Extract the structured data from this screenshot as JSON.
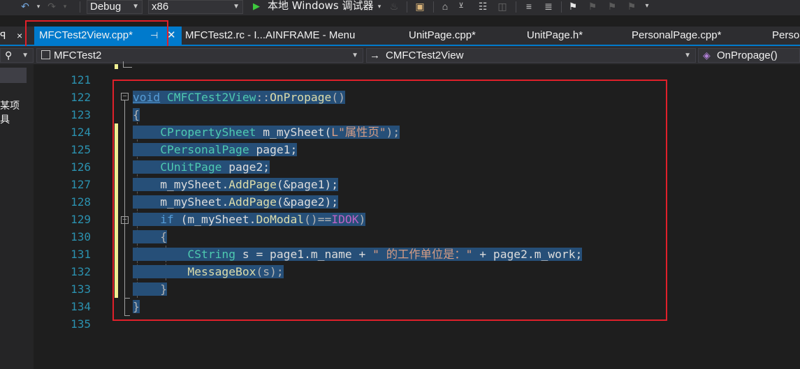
{
  "toolbar": {
    "configuration": "Debug",
    "platform": "x86",
    "run_label": "本地 Windows 调试器"
  },
  "tabs": [
    {
      "label": "MFCTest2View.cpp*",
      "active": true
    },
    {
      "label": "MFCTest2.rc - I...AINFRAME - Menu"
    },
    {
      "label": "UnitPage.cpp*"
    },
    {
      "label": "UnitPage.h*"
    },
    {
      "label": "PersonalPage.cpp*"
    },
    {
      "label": "Perso"
    }
  ],
  "navbar": {
    "project": "MFCTest2",
    "class": "CMFCTest2View",
    "member": "OnPropage()"
  },
  "side_panel": {
    "items": [
      "某项",
      "具"
    ]
  },
  "editor": {
    "lines": [
      {
        "num": "121"
      },
      {
        "num": "122"
      },
      {
        "num": "123"
      },
      {
        "num": "124"
      },
      {
        "num": "125"
      },
      {
        "num": "126"
      },
      {
        "num": "127"
      },
      {
        "num": "128"
      },
      {
        "num": "129"
      },
      {
        "num": "130"
      },
      {
        "num": "131"
      },
      {
        "num": "132"
      },
      {
        "num": "133"
      },
      {
        "num": "134"
      },
      {
        "num": "135"
      }
    ],
    "code": {
      "l122": {
        "kw": "void",
        "cls": "CMFCTest2View",
        "sep": "::",
        "fn": "OnPropage",
        "rest": "()"
      },
      "l123": {
        "text": "{"
      },
      "l124": {
        "ty": "CPropertySheet",
        "var": " m_mySheet(",
        "str": "L\"属性页\"",
        "rest": ");"
      },
      "l125": {
        "ty": "CPersonalPage",
        "rest": " page1;"
      },
      "l126": {
        "ty": "CUnitPage",
        "rest": " page2;"
      },
      "l127": {
        "var": "m_mySheet.",
        "fn": "AddPage",
        "rest": "(&page1);"
      },
      "l128": {
        "var": "m_mySheet.",
        "fn": "AddPage",
        "rest": "(&page2);"
      },
      "l129": {
        "kw": "if",
        "var": " (m_mySheet.",
        "fn": "DoModal",
        "rest": "()==",
        "mc": "IDOK",
        "end": ")"
      },
      "l130": {
        "text": "{"
      },
      "l131": {
        "ty": "CString",
        "var": " s = page1.m_name + ",
        "str": "\" 的工作单位是：\"",
        "rest": " + page2.m_work;"
      },
      "l132": {
        "fn": "MessageBox",
        "rest": "(s);"
      },
      "l133": {
        "text": "}"
      },
      "l134": {
        "text": "}"
      }
    }
  },
  "colors": {
    "accent_tab": "#007acc",
    "selection": "#264f78",
    "highlight_box": "#e0202a",
    "keyword": "#569cd6",
    "type": "#4ec9b0",
    "function": "#dcdcaa",
    "string": "#d69d85",
    "macro": "#bd63c5",
    "line_number": "#2b91af",
    "change_bar": "#efef91"
  }
}
